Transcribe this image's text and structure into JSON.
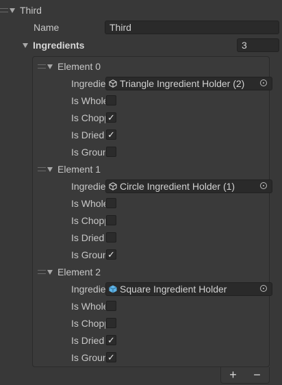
{
  "header": {
    "title": "Third"
  },
  "name_field": {
    "label": "Name",
    "value": "Third"
  },
  "ingredients": {
    "label": "Ingredients",
    "count": "3"
  },
  "elements": [
    {
      "title": "Element 0",
      "ingredient_label": "Ingredient",
      "ingredient_value": "Triangle Ingredient Holder (2)",
      "ingredient_icon": "cube-outline-icon",
      "bools": [
        {
          "label": "Is Whole",
          "checked": false
        },
        {
          "label": "Is Chopped",
          "checked": true
        },
        {
          "label": "Is Dried",
          "checked": true
        },
        {
          "label": "Is Ground",
          "checked": false
        }
      ]
    },
    {
      "title": "Element 1",
      "ingredient_label": "Ingredient",
      "ingredient_value": "Circle Ingredient Holder (1)",
      "ingredient_icon": "cube-outline-icon",
      "bools": [
        {
          "label": "Is Whole",
          "checked": false
        },
        {
          "label": "Is Chopped",
          "checked": false
        },
        {
          "label": "Is Dried",
          "checked": false
        },
        {
          "label": "Is Ground",
          "checked": true
        }
      ]
    },
    {
      "title": "Element 2",
      "ingredient_label": "Ingredient",
      "ingredient_value": "Square Ingredient Holder",
      "ingredient_icon": "prefab-cube-icon",
      "bools": [
        {
          "label": "Is Whole",
          "checked": false
        },
        {
          "label": "Is Chopped",
          "checked": false
        },
        {
          "label": "Is Dried",
          "checked": true
        },
        {
          "label": "Is Ground",
          "checked": true
        }
      ]
    }
  ],
  "footer": {
    "add": "+",
    "remove": "−"
  },
  "colors": {
    "background": "#383838",
    "field": "#2a2a2a",
    "prefab_icon": "#5fb3e6"
  }
}
